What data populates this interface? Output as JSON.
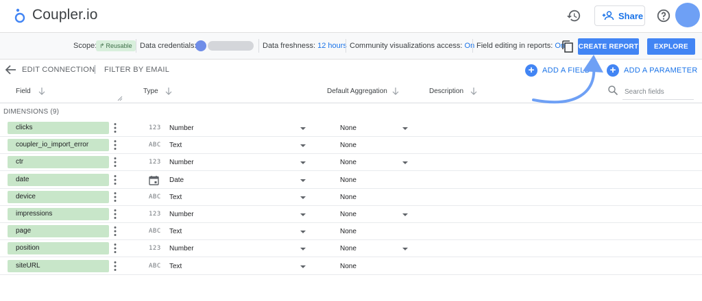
{
  "header": {
    "app_name": "Coupler.io",
    "share_label": "Share"
  },
  "infobar": {
    "scope_label": "Scope:",
    "scope_badge": "Reusable",
    "credentials_label": "Data credentials:",
    "freshness_label": "Data freshness:",
    "freshness_value": "12 hours",
    "community_label": "Community visualizations access:",
    "community_value": "On",
    "field_editing_label": "Field editing in reports:",
    "field_editing_value": "On",
    "create_report_label": "CREATE REPORT",
    "explore_label": "EXPLORE"
  },
  "subnav": {
    "edit_connection": "EDIT CONNECTION",
    "filter_by_email": "FILTER BY EMAIL",
    "add_field": "ADD A FIELD",
    "add_parameter": "ADD A PARAMETER"
  },
  "columns": {
    "field": "Field",
    "type": "Type",
    "default_aggregation": "Default Aggregation",
    "description": "Description"
  },
  "search": {
    "placeholder": "Search fields"
  },
  "dimensions_label": "DIMENSIONS (9)",
  "rows": [
    {
      "name": "clicks",
      "type": "Number",
      "type_icon": "123",
      "aggregation": "None",
      "agg_dropdown": true
    },
    {
      "name": "coupler_io_import_error",
      "type": "Text",
      "type_icon": "ABC",
      "aggregation": "None",
      "agg_dropdown": false
    },
    {
      "name": "ctr",
      "type": "Number",
      "type_icon": "123",
      "aggregation": "None",
      "agg_dropdown": true
    },
    {
      "name": "date",
      "type": "Date",
      "type_icon": "calendar",
      "aggregation": "None",
      "agg_dropdown": false
    },
    {
      "name": "device",
      "type": "Text",
      "type_icon": "ABC",
      "aggregation": "None",
      "agg_dropdown": false
    },
    {
      "name": "impressions",
      "type": "Number",
      "type_icon": "123",
      "aggregation": "None",
      "agg_dropdown": true
    },
    {
      "name": "page",
      "type": "Text",
      "type_icon": "ABC",
      "aggregation": "None",
      "agg_dropdown": false
    },
    {
      "name": "position",
      "type": "Number",
      "type_icon": "123",
      "aggregation": "None",
      "agg_dropdown": true
    },
    {
      "name": "siteURL",
      "type": "Text",
      "type_icon": "ABC",
      "aggregation": "None",
      "agg_dropdown": false
    }
  ],
  "colors": {
    "accent": "#4285f4",
    "link": "#1a73e8",
    "chip": "#c8e6c9",
    "annotation_arrow": "#6ea0f5"
  }
}
